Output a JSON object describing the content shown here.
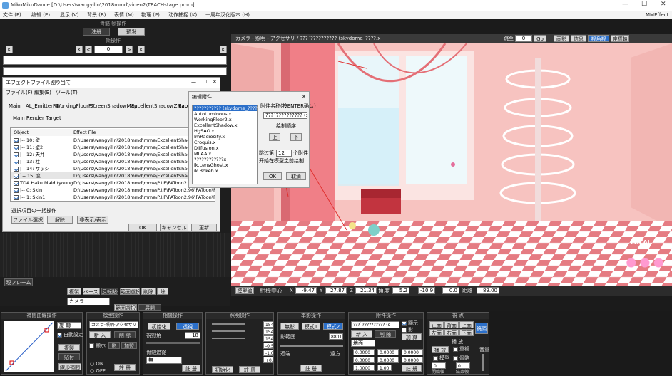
{
  "titlebar": {
    "title": "MikuMikuDance [D:\\Users\\wangyilin\\2018mmd\\video2\\TEACHstage.pmm]",
    "min": "—",
    "max": "☐",
    "close": "✕"
  },
  "menubar": {
    "items": [
      "文件 (F)",
      "编辑 (E)",
      "显示 (V)",
      "背景 (B)",
      "表情 (M)",
      "物理 (P)",
      "动作捕捉 (K)",
      "十周年汉化版本 (H)"
    ],
    "right": "MMEffect"
  },
  "left": {
    "bone_title": "骨骼·帧操作",
    "reg_btn": "注册",
    "sel_btn": "预发",
    "frame_title": "帧操作",
    "frame_value": "0",
    "k_left": "K",
    "k_right": "K",
    "lt": "<",
    "gt": ">",
    "model_btn": "模型",
    "camera_select": "カメラ",
    "frame_label": "現フレーム",
    "btn_copy": "複製",
    "btn_paste": "ペースト",
    "btn_reverse": "反転貼付",
    "btn_range": "範囲選択",
    "btn_delete": "削除",
    "btn_deltext": "除",
    "btn_range_sel": "範囲選択",
    "btn_expand": "展開"
  },
  "effect_dialog": {
    "title": "エフェクトファイル割り当て",
    "menu": [
      "ファイル(F)",
      "編集(E)",
      "ツール(T)"
    ],
    "tabs": [
      "Main",
      "AL_EmitterRT",
      "WorkingFloorRT",
      "ScreenShadowMap",
      "ExcellentShadowZMap",
      "Excell"
    ],
    "section": "Main Render Target",
    "col_object": "Object",
    "col_file": "Effect File",
    "rows": [
      {
        "obj": "|-- 10: 壁",
        "file": "D:\\Users\\wangyilin\\2018mmd\\mme\\ExcellentShadow2\\fu"
      },
      {
        "obj": "|-- 11: 壁2",
        "file": "D:\\Users\\wangyilin\\2018mmd\\mme\\ExcellentShadow2\\fu"
      },
      {
        "obj": "|-- 12: 天井",
        "file": "D:\\Users\\wangyilin\\2018mmd\\mme\\ExcellentShadow2\\fu"
      },
      {
        "obj": "|-- 13: 柱",
        "file": "D:\\Users\\wangyilin\\2018mmd\\mme\\ExcellentShadow2\\fu"
      },
      {
        "obj": "|-- 14: サッシ",
        "file": "D:\\Users\\wangyilin\\2018mmd\\mme\\ExcellentShadow2\\fu"
      },
      {
        "obj": "`-- 15: 窓",
        "file": "D:\\Users\\wangyilin\\2018mmd\\mme\\ExcellentShadow2\\fu"
      },
      {
        "obj": "TDA Haku Maid (young ...",
        "file": "D:\\Users\\wangyilin\\2018mmd\\mme\\P.I.P\\PAToon2.96\\PAToon\\PAT..."
      },
      {
        "obj": "|-- 0: Skin",
        "file": "D:\\Users\\wangyilin\\2018mmd\\mme\\P.I.P\\PAToon2.96\\PAToon\\PAT..."
      },
      {
        "obj": "|-- 1: Skin1",
        "file": "D:\\Users\\wangyilin\\2018mmd\\mme\\P.I.P\\PAToon2.96\\PAToon\\PAT..."
      }
    ],
    "batch_title": "選択項目の一括操作",
    "btn_file": "ファイル選択",
    "btn_clear": "解除",
    "btn_toggle": "非表示/表示",
    "ok": "OK",
    "cancel": "キャンセル",
    "update": "更新"
  },
  "accessory_dialog": {
    "title": "编辑附件",
    "list": [
      "??????????? (skydome_????.x",
      "AutoLuminous.x",
      "WorkingFloor2.x",
      "ExcellentShadow.x",
      "HgSAO.x",
      "ImRadiosity.x",
      "Croquis.x",
      "Diffusion.x",
      "MLAA.x",
      "????????????x",
      "ik.LensGhost.x",
      "ik.Bokeh.x"
    ],
    "name_label": "附件名称(按ENTER确认)",
    "name_value": "???`?????????? (skyd",
    "order_label": "绘制顺序",
    "up": "上",
    "down": "下",
    "skip_pre": "跳过第",
    "skip_value": "12",
    "skip_post": "个附件",
    "skip_note": "开始在模型之前绘制",
    "ok": "OK",
    "cancel": "取消"
  },
  "viewport": {
    "header": "カメラ・照明・アクセサリ / ???`?????????? (skydome_????.x",
    "frame_label": "跳至",
    "frame_value": "0",
    "go": "Go",
    "view_btns": [
      "画影",
      "信息",
      "视角视",
      "座標軸"
    ],
    "local": "LOCAL",
    "status": {
      "mode": "模型编",
      "center_label": "相機中心",
      "x_label": "X",
      "x": "-9.47",
      "y_label": "Y",
      "y": "27.87",
      "z_label": "Z",
      "z": "21.34",
      "angle_label": "角度",
      "ax": "5.2",
      "ay": "-10.9",
      "az": "0.0",
      "dist_label": "距離",
      "dist": "89.00"
    }
  },
  "bottom": {
    "curve": {
      "title": "補間曲線操作",
      "rot": "旋 轉",
      "auto": "自動設定",
      "copy": "複製",
      "paste": "貼付",
      "linear": "線形補間"
    },
    "model": {
      "title": "模型操作",
      "select": "カメラ·照明·アクセサリ",
      "add": "新 入",
      "del": "削 除",
      "disp": "顯示",
      "shadow": "影",
      "add2": "加盟",
      "on": "ON",
      "off": "OFF",
      "reg": "註 册"
    },
    "camera": {
      "title": "相機操作",
      "init": "初始化",
      "persp": "透視",
      "fov_label": "視野角",
      "fov": "18",
      "follow": "骨骼追從",
      "follow_val": "無",
      "reg": "註 册"
    },
    "light": {
      "title": "照明操作",
      "r": "154",
      "g": "154",
      "b": "154",
      "x": "-0.5",
      "y": "-1.0",
      "z": "+0.5",
      "init": "初始化",
      "reg": "註 册"
    },
    "selfshadow": {
      "title": "本影操作",
      "none": "無影",
      "mode1": "模式1",
      "mode2": "模式2",
      "range": "影範囲",
      "range_val": "8801",
      "near": "近端",
      "far": "遠方",
      "reg": "註 册"
    },
    "accessory": {
      "title": "附件操作",
      "select": "???`?????????? (s",
      "disp": "顯示",
      "shadow": "影",
      "add": "新 入",
      "del": "削 除",
      "add2": "加 算",
      "ground": "地面",
      "x": "0.0000",
      "y": "0.0000",
      "z": "0.0000",
      "rx": "0.0000",
      "ry": "0.0000",
      "rz": "0.0000",
      "si": "1.0000",
      "tr": "1.00",
      "reg": "註 册"
    },
    "view": {
      "title": "視 点",
      "front": "正面",
      "back": "背面",
      "top": "上面",
      "left": "左面",
      "right": "右面",
      "bottom": "下面",
      "camera": "鏡頭",
      "play_title": "播 放",
      "play": "播 放",
      "loop": "重複",
      "model_chk": "模型",
      "bone_chk": "骨骼",
      "start_label": "開始幀",
      "start": "0",
      "end_label": "結束幀",
      "end": "0",
      "vol_label": "音量"
    }
  }
}
